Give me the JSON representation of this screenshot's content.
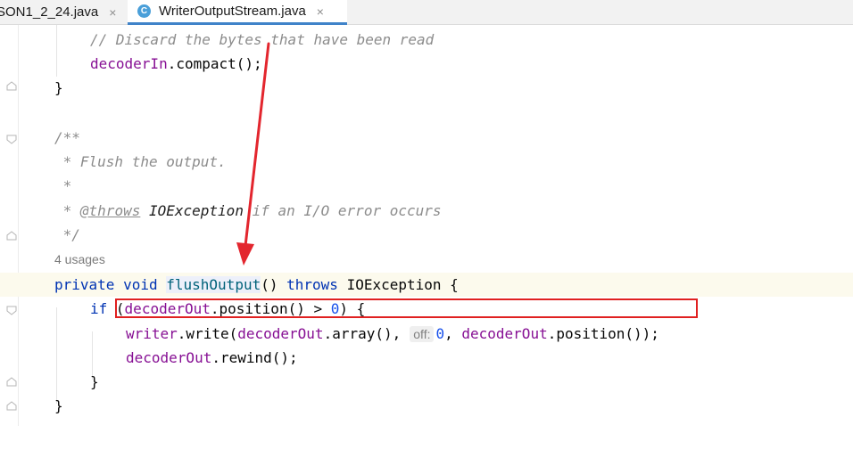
{
  "tabs": [
    {
      "label": "SON1_2_24.java",
      "close": "×",
      "active": false
    },
    {
      "label": "WriterOutputStream.java",
      "close": "×",
      "active": true,
      "icon_letter": "C"
    }
  ],
  "code": {
    "comment_discard": "// Discard the bytes that have been read",
    "decoder_in": "decoderIn",
    "compact_call": ".compact();",
    "close_brace": "}",
    "doc_open": "/**",
    "doc_flush": " * Flush the output.",
    "doc_star": " *",
    "doc_star_prefix": " * ",
    "doc_throws_tag": "@throws",
    "doc_exception": "IOException",
    "doc_throws_desc": " if an I/O error occurs",
    "doc_close": " */",
    "usages": "4 usages",
    "kw_private": "private",
    "kw_void": "void",
    "method_name": "flushOutput",
    "paren_pair": "()",
    "kw_throws": "throws",
    "exception_type": "IOException",
    "open_brace": "{",
    "kw_if": "if",
    "paren_open": "(",
    "decoder_out": "decoderOut",
    "position_call": ".position()",
    "gt": " > ",
    "zero": "0",
    "if_tail": ") {",
    "writer": "writer",
    "write_call": ".write(",
    "array_call": ".array(),",
    "hint_off": "off:",
    "comma_space": ", ",
    "position_tail": ".position());",
    "rewind_call": ".rewind();"
  },
  "colors": {
    "keyword": "#0033b3",
    "field": "#871094",
    "number": "#1750eb",
    "method": "#00627a",
    "comment": "#8c8c8c",
    "annotation_box": "#e02020",
    "arrow": "#e3262e",
    "active_tab_underline": "#4083c9"
  }
}
